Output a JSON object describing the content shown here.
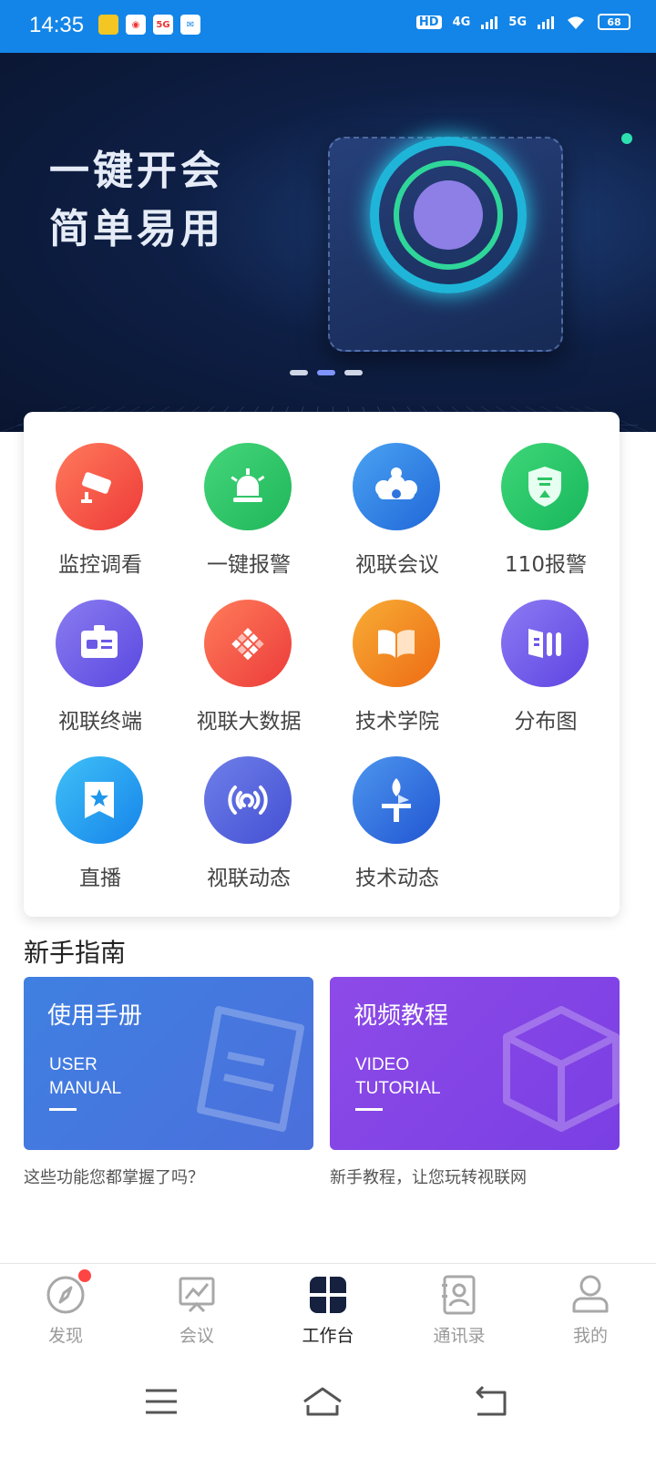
{
  "status": {
    "time": "14:35",
    "battery": "68",
    "network": [
      "4G",
      "5G"
    ],
    "hd_label": "HD"
  },
  "banner": {
    "line1": "一键开会",
    "line2": "简单易用",
    "slide_index": 2,
    "slide_count": 3
  },
  "functions": [
    {
      "label": "监控调看",
      "icon": "camera-icon",
      "color": "#f0463c"
    },
    {
      "label": "一键报警",
      "icon": "alarm-icon",
      "color": "#2cc463"
    },
    {
      "label": "视联会议",
      "icon": "meeting-icon",
      "color": "#2f7fe0"
    },
    {
      "label": "110报警",
      "icon": "police-shield-icon",
      "color": "#22c46a"
    },
    {
      "label": "视联终端",
      "icon": "id-card-icon",
      "color": "#6a5ae6"
    },
    {
      "label": "视联大数据",
      "icon": "data-grid-icon",
      "color": "#f0483a"
    },
    {
      "label": "技术学院",
      "icon": "book-icon",
      "color": "#f28a1e"
    },
    {
      "label": "分布图",
      "icon": "distribution-icon",
      "color": "#6d55e9"
    },
    {
      "label": "直播",
      "icon": "live-star-icon",
      "color": "#1e97ee"
    },
    {
      "label": "视联动态",
      "icon": "broadcast-icon",
      "color": "#4f63dd"
    },
    {
      "label": "技术动态",
      "icon": "flag-tower-icon",
      "color": "#2d6fe0"
    }
  ],
  "guide": {
    "title": "新手指南",
    "manual": {
      "title": "使用手册",
      "subtitle": "USER\nMANUAL",
      "desc": "这些功能您都掌握了吗？"
    },
    "video": {
      "title": "视频教程",
      "subtitle": "VIDEO\nTUTORIAL",
      "desc": "新手教程，让您玩转视联网"
    }
  },
  "bottom_nav": [
    {
      "label": "发现",
      "icon": "compass-icon",
      "active": false,
      "badge": true
    },
    {
      "label": "会议",
      "icon": "presentation-icon",
      "active": false,
      "badge": false
    },
    {
      "label": "工作台",
      "icon": "workbench-icon",
      "active": true,
      "badge": false
    },
    {
      "label": "通讯录",
      "icon": "contacts-icon",
      "active": false,
      "badge": false
    },
    {
      "label": "我的",
      "icon": "profile-icon",
      "active": false,
      "badge": false
    }
  ],
  "colors": {
    "status_bar": "#1385e8",
    "active_nav": "#222222",
    "inactive_nav": "#9a9a9a"
  }
}
